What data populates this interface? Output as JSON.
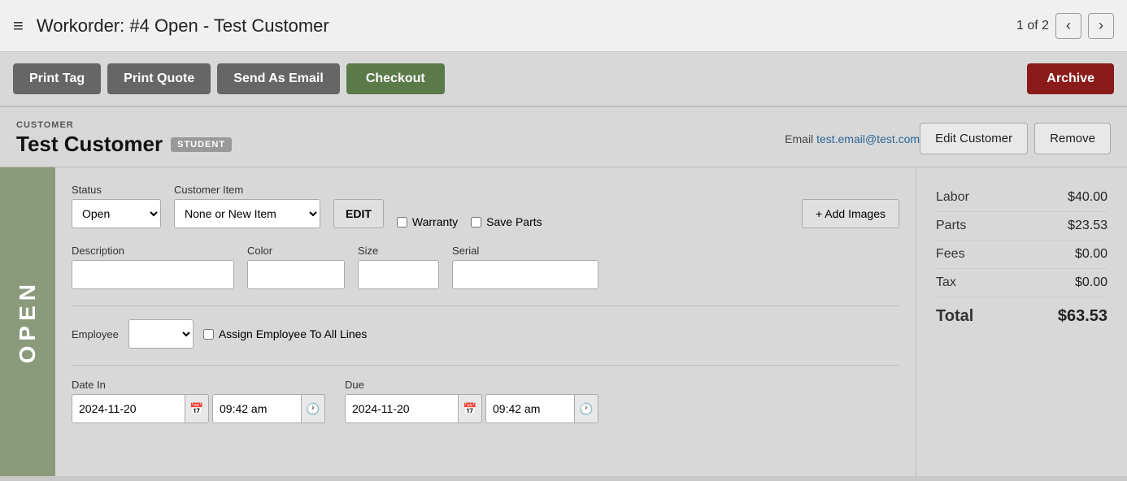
{
  "topbar": {
    "title": "Workorder: #4 Open - Test Customer",
    "page_info": "1 of 2",
    "nav_prev": "‹",
    "nav_next": "›",
    "hamburger": "≡"
  },
  "toolbar": {
    "print_tag_label": "Print Tag",
    "print_quote_label": "Print Quote",
    "send_as_email_label": "Send As Email",
    "checkout_label": "Checkout",
    "archive_label": "Archive"
  },
  "customer": {
    "section_label": "CUSTOMER",
    "name": "Test Customer",
    "badge": "STUDENT",
    "email_prefix": "Email",
    "email": "test.email@test.com",
    "edit_button": "Edit Customer",
    "remove_button": "Remove"
  },
  "open_label": "OPEN",
  "form": {
    "status_label": "Status",
    "status_value": "Open",
    "customer_item_label": "Customer Item",
    "customer_item_value": "None or New Item",
    "edit_label": "EDIT",
    "warranty_label": "Warranty",
    "save_parts_label": "Save Parts",
    "add_images_label": "+ Add Images",
    "description_label": "Description",
    "color_label": "Color",
    "size_label": "Size",
    "serial_label": "Serial",
    "employee_label": "Employee",
    "assign_employee_label": "Assign Employee To All Lines",
    "date_in_label": "Date In",
    "due_label": "Due",
    "date_in_value": "2024-11-20",
    "time_in_value": "09:42 am",
    "due_date_value": "2024-11-20",
    "due_time_value": "09:42 am"
  },
  "summary": {
    "labor_label": "Labor",
    "labor_value": "$40.00",
    "parts_label": "Parts",
    "parts_value": "$23.53",
    "fees_label": "Fees",
    "fees_value": "$0.00",
    "tax_label": "Tax",
    "tax_value": "$0.00",
    "total_label": "Total",
    "total_value": "$63.53"
  }
}
